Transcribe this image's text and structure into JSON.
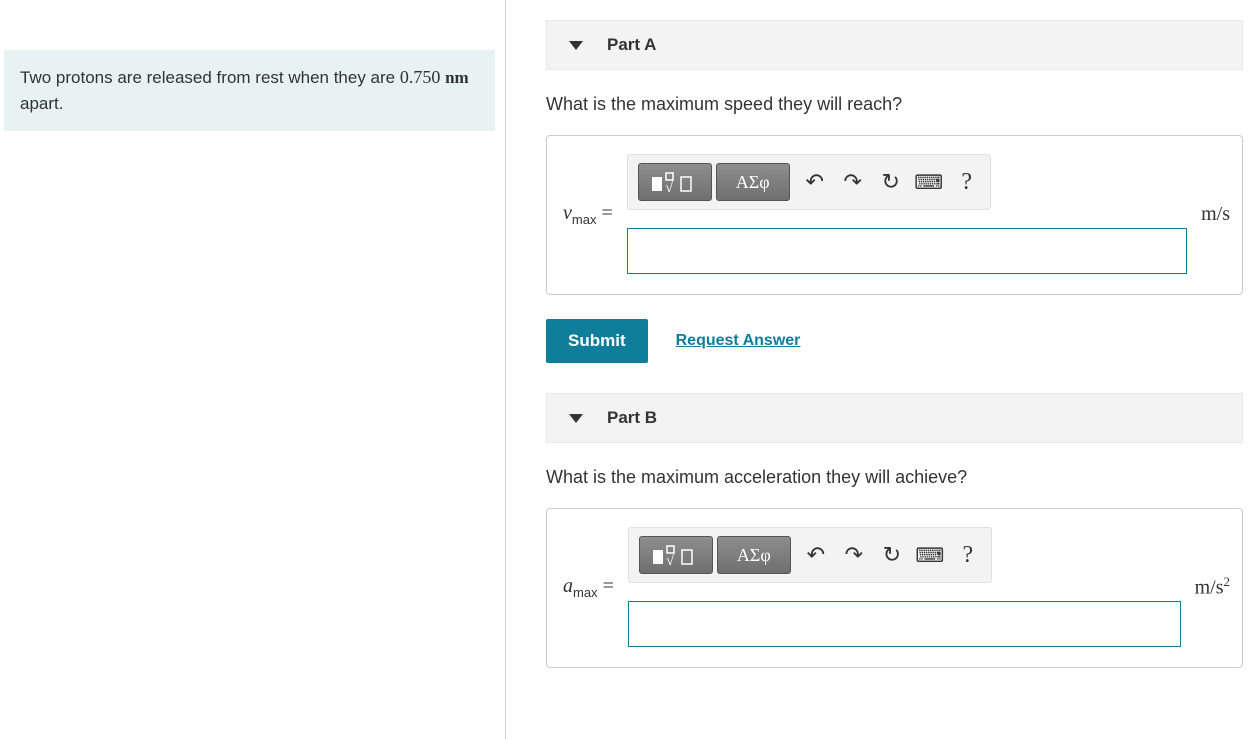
{
  "problem": {
    "text_before_value": "Two protons are released from rest when they are ",
    "value": "0.750",
    "unit": "nm",
    "text_after_unit": " apart."
  },
  "parts": [
    {
      "header": "Part A",
      "question": "What is the maximum speed they will reach?",
      "var_symbol": "v",
      "var_sub": "max",
      "unit_html": "m/s",
      "submit": "Submit",
      "request": "Request Answer"
    },
    {
      "header": "Part B",
      "question": "What is the maximum acceleration they will achieve?",
      "var_symbol": "a",
      "var_sub": "max",
      "unit_html": "m/s²"
    }
  ],
  "toolbar": {
    "template_button": "template",
    "greek_button": "ΑΣφ",
    "undo": "undo",
    "redo": "redo",
    "reset": "reset",
    "keyboard": "keyboard",
    "help": "?"
  }
}
